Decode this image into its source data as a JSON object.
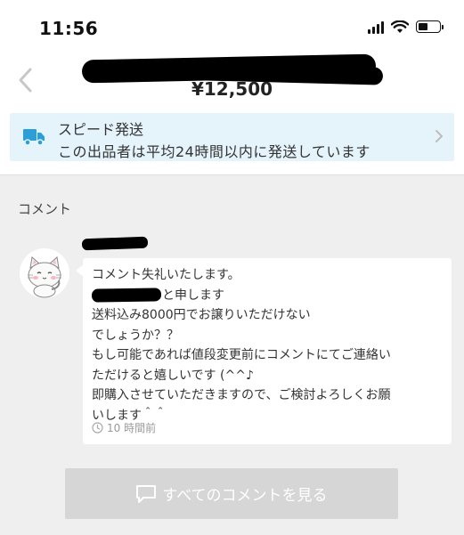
{
  "status_bar": {
    "time": "11:56"
  },
  "header": {
    "price": "¥12,500"
  },
  "shipping": {
    "title": "スピード発送",
    "description": "この出品者は平均24時間以内に発送しています"
  },
  "comments": {
    "heading": "コメント",
    "items": [
      {
        "lines": [
          "コメント失礼いたします。",
          "と申します",
          "送料込み8000円でお譲りいただけない",
          "でしょうか？？",
          "もし可能であれば値段変更前にコメントにてご連絡い",
          "ただけると嬉しいです (^^♪",
          "即購入させていただきますので、ご検討よろしくお願",
          "いします＾＾"
        ],
        "time": "10 時間前"
      }
    ],
    "view_all_label": "すべてのコメントを見る"
  },
  "colors": {
    "banner_bg": "#e5f3fb",
    "truck_icon": "#2d9fd8",
    "comments_bg": "#efefef",
    "button_bg": "#d6d6d6"
  }
}
